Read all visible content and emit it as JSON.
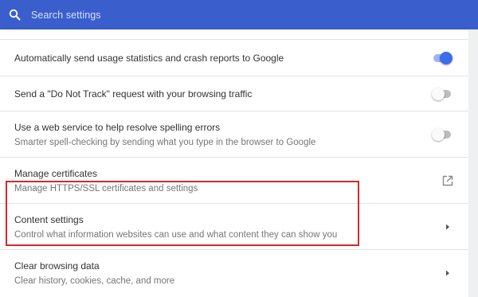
{
  "header": {
    "search_placeholder": "Search settings",
    "color": "#3a5fcd"
  },
  "rows": [
    {
      "title": "Automatically send usage statistics and crash reports to Google",
      "control": "toggle",
      "state": "on"
    },
    {
      "title": "Send a \"Do Not Track\" request with your browsing traffic",
      "control": "toggle",
      "state": "off"
    },
    {
      "title": "Use a web service to help resolve spelling errors",
      "subtitle": "Smarter spell-checking by sending what you type in the browser to Google",
      "control": "toggle",
      "state": "off"
    },
    {
      "title": "Manage certificates",
      "subtitle": "Manage HTTPS/SSL certificates and settings",
      "control": "external-link-icon"
    },
    {
      "title": "Content settings",
      "subtitle": "Control what information websites can use and what content they can show you",
      "control": "chevron-right-icon",
      "highlighted": true
    },
    {
      "title": "Clear browsing data",
      "subtitle": "Clear history, cookies, cache, and more",
      "control": "chevron-right-icon"
    }
  ],
  "colors": {
    "toggle_on": "#3b6ee8",
    "highlight_border": "#d7282a"
  }
}
